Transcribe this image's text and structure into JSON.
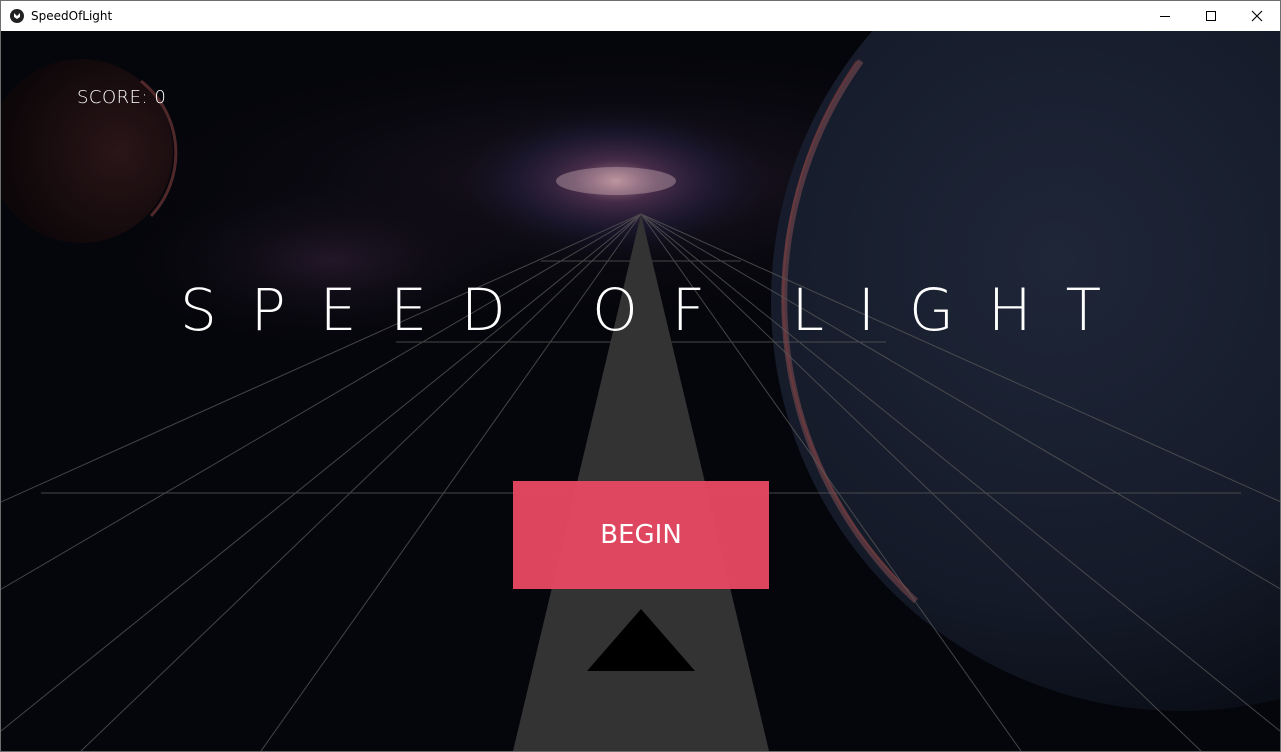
{
  "window": {
    "title": "SpeedOfLight",
    "controls": [
      "minimize",
      "maximize",
      "close"
    ]
  },
  "hud": {
    "score_text": "SCORE: 0"
  },
  "game_title": "SPEED OF LIGHT",
  "begin_button": {
    "label": "BEGIN"
  },
  "colors": {
    "button": "#e84962",
    "road": "#333333",
    "grid": "#5a5a5a",
    "player": "#000000"
  },
  "icons": {
    "app": "kivy-icon",
    "player": "triangle-ship-icon"
  }
}
